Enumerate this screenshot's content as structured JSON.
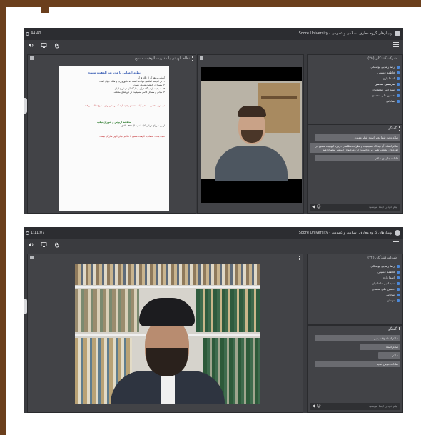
{
  "screenshot1": {
    "timer": "44:40",
    "window_title": "وبینارهای گروه معارف اسلامی و عمومی - Soore University",
    "document_pod_title": "نظام الهیاتی یا مدیریت الوهیت مسیح",
    "document": {
      "heading": "نظام الهیاتی یا مدیریت الوهیت مسیح",
      "lines": [
        "آشنایی و نقد آن از نگاه قرآن",
        "۱- در اندیشه اسلامی تنها خدا است که خالق و رب و مالک جهان است",
        "۲- مسیح در الوهیت شریک نیست",
        "۳- مسیحیت از دیدگاه قرآن و جایگاه آن در تاریخ ادیان",
        "۴- مبانی و مسائل کلامی مسیحیت در دوره‌های مختلف"
      ],
      "red_text": "در متون مقدس مسیحی آیات متعددی وجود دارد که بر بشر بودن مسیح دلالت می‌کنند",
      "green_heading": "مناقشه آریوس و شورای نیقیه",
      "green_line": "اولین شورای جهانی کلیسا در سال ۳۲۵ میلادی",
      "bottom_red": "نتیجه بحث: اعتقاد به الوهیت مسیح با تعالیم انبیای الهی سازگار نیست"
    },
    "attendees_title": "شرکت‌کنندگان (۲۵)",
    "attendees": [
      "رضا رضایی توسلکی",
      "فاطمه حسینی",
      "اسما بارع",
      "مرتضی شاهی",
      "سید امیر سلطانیان",
      "حسین علی محمدی",
      "ساداتی"
    ],
    "chat_title": "گفتگو",
    "chat_messages": [
      "سلام وقت شما بخیر استاد شکر ممنون",
      "سلام استاد: آیا دیدگاه مسیحیت و نظرات متکلمان درباره الوهیت مسیح در دوره‌های مختلف تغییر کرده است؟ این موضوع را بیشتر توضیح دهید",
      "فاطمه جاویدی سلام"
    ],
    "chat_placeholder": "پیام خود را اینجا بنویسید"
  },
  "screenshot2": {
    "timer": "1:11:07",
    "window_title": "وبینارهای گروه معارف اسلامی و عمومی - Soore University",
    "attendees_title": "شرکت‌کنندگان (۲۴)",
    "attendees": [
      "رضا رضایی توسلکی",
      "فاطمه حسینی",
      "اسما بارع",
      "سید امیر سلطانیان",
      "حسین علی محمدی",
      "ساداتی",
      "مهمان"
    ],
    "chat_title": "گفتگو",
    "chat_messages": [
      "سلام استاد وقت بخیر",
      "سلام استاد",
      "سلام",
      "سادات خوش آمدید"
    ],
    "chat_placeholder": "پیام خود را اینجا بنویسید"
  },
  "icons": {
    "timer": "clock-icon",
    "audio": "speaker-icon",
    "screen": "screen-share-icon",
    "hand": "raise-hand-icon",
    "menu": "menu-icon",
    "send": "send-icon",
    "emoji": "emoji-icon"
  },
  "colors": {
    "frame": "#6b3f1d",
    "app_background": "#3a3b3f",
    "attendee_icon": "#4b88d8",
    "doc_heading": "#3b5fb5",
    "doc_red": "#c0262a",
    "doc_green": "#2a7a2a"
  }
}
